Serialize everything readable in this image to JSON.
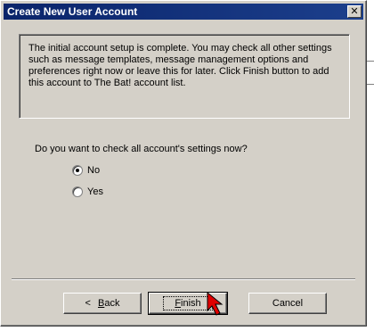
{
  "window": {
    "title": "Create New User Account",
    "close_glyph": "✕"
  },
  "info": {
    "text": "The initial account setup is complete. You may check all other settings such as message templates, message management options and preferences right now or leave this for later. Click Finish button to add this account to The Bat! account list."
  },
  "question": {
    "label": "Do you want to check all account's settings now?",
    "options": [
      {
        "label": "No",
        "selected": true
      },
      {
        "label": "Yes",
        "selected": false
      }
    ]
  },
  "buttons": {
    "back_arrow": "<",
    "back_key": "B",
    "back_rest": "ack",
    "finish_key": "F",
    "finish_rest": "inish",
    "cancel": "Cancel"
  },
  "colors": {
    "titlebar": "#0a246a",
    "face": "#d4d0c8",
    "cursor": "#e00000"
  }
}
